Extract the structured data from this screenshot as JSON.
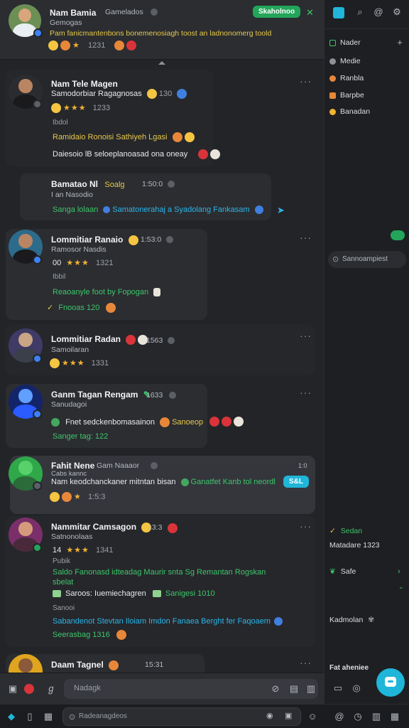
{
  "pinned": {
    "name": "Nam Bamia",
    "handle": "Gamelados",
    "sub": "Gemogas",
    "message": "Pam fanicmantenbons bonemenosiagh toost an ladnonomerg toold",
    "stars": "★",
    "count": "1231",
    "button": "Skaholnoo",
    "close": "✕"
  },
  "messages": [
    {
      "name": "Nam Tele Magen",
      "sub": "Samodorbiar Ragagnosas",
      "count1": "130",
      "stars": "★★★",
      "count2": "1233",
      "label": "Ibdol",
      "line1": "Ramidaio Ronoisi Sathiyeh Lgasi",
      "line2": "Daiesoio lB seloeplanoasad ona oneay"
    },
    {
      "name": "Bamatao Nl",
      "tag": "Soalg",
      "time": "1:50:0",
      "sub": "I an Nasodio",
      "line": "Sanga lolaan",
      "link": "Samatonerahaj a Syadolang Fankasam"
    },
    {
      "name": "Lommitiar Ranaio",
      "time": "1:53:0",
      "sub": "Ramosor Nasdis",
      "prefix": "00",
      "stars": "★★★",
      "count": "1321",
      "label": "Ibbil",
      "line1": "Reaoanyle foot by Fopogan",
      "line2": "Fnooas 120"
    },
    {
      "name": "Lommitiar Radan",
      "time": "1563",
      "sub": "Samoilaran",
      "stars": "★★★",
      "count": "1331"
    },
    {
      "name": "Ganm Tagan Rengam",
      "time": "1633",
      "sub": "Sanudagoi",
      "line1": "Fnet sedckenbomasainon",
      "tag": "Sanoeop",
      "line2": "Sanger tag: 122"
    },
    {
      "name": "Fahit Nene",
      "handle": "Gam Naaaor",
      "time": "1:0",
      "sub": "Cabs kannc",
      "line": "Nam keodchanckaner mitntan bisan",
      "link": "Ganatfet Kanb tol neordl",
      "pill": "S&L",
      "stars": "★",
      "count": "1:5:3"
    },
    {
      "name": "Nammitar Camsagon",
      "time": "13:3",
      "sub": "Satnonolaas",
      "prefix": "14",
      "stars": "★★★",
      "count": "1341",
      "label": "Pubik",
      "line1": "Saldo Fanonasd idteadag Maurir snta Sg Remantan Rogskan",
      "line1b": "sbelat",
      "line2": "Saroos: Iuemiechagren",
      "tag2": "Sanigesi 1010",
      "label2": "Sanooi",
      "link": "Sabandenot Stevtan Iloiam Imdon Fanaea Berght fer Faqoaem",
      "line3": "Seerasbag 1316"
    },
    {
      "name": "Daam Tagnel",
      "time": "15:31"
    }
  ],
  "composer": {
    "placeholder": "Nadagk"
  },
  "bottom": {
    "placeholder": "Radeanagdeos"
  },
  "sidebar": {
    "channels": [
      {
        "label": "Nader",
        "color": "#3ec56b"
      },
      {
        "label": "Medie",
        "color": "#8e9297"
      },
      {
        "label": "Ranbla",
        "color": "#e8873a"
      },
      {
        "label": "Barpbe",
        "color": "#e8873a"
      },
      {
        "label": "Banadan",
        "color": "#f0b232"
      }
    ],
    "search": "Sannoampiest",
    "status1": "Sedan",
    "status2": "Matadare 1323",
    "status3": "Safe",
    "status4": "Kadmolan",
    "footer": "Fat aheniee"
  }
}
